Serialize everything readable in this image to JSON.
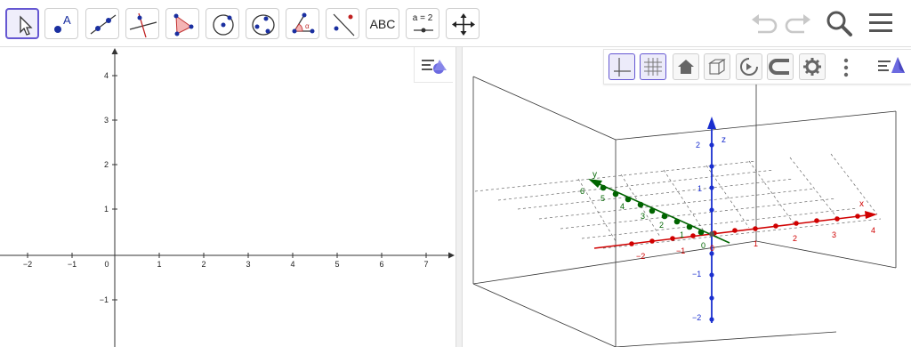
{
  "toolbar": {
    "tools": [
      {
        "name": "move-tool",
        "active": true
      },
      {
        "name": "point-tool"
      },
      {
        "name": "line-tool"
      },
      {
        "name": "perpendicular-line-tool"
      },
      {
        "name": "polygon-tool"
      },
      {
        "name": "circle-center-point-tool"
      },
      {
        "name": "circle-three-points-tool"
      },
      {
        "name": "angle-tool"
      },
      {
        "name": "reflect-about-line-tool"
      },
      {
        "name": "text-tool",
        "label": "ABC"
      },
      {
        "name": "slider-tool",
        "label": "a = 2"
      },
      {
        "name": "move-graphics-view-tool"
      }
    ],
    "right_icons": [
      "undo-icon",
      "redo-icon",
      "search-icon",
      "menu-icon"
    ]
  },
  "graphics2d": {
    "x_ticks": [
      "−2",
      "−1",
      "0",
      "1",
      "2",
      "3",
      "4",
      "5",
      "6",
      "7"
    ],
    "y_ticks": [
      "4",
      "3",
      "2",
      "1",
      "−1"
    ]
  },
  "graphics3d": {
    "x_ticks": [
      "−2",
      "−1",
      "0",
      "1",
      "2",
      "3",
      "4"
    ],
    "y_ticks": [
      "0",
      "1",
      "2",
      "3",
      "4",
      "5",
      "6"
    ],
    "z_ticks": [
      "2",
      "1",
      "−1",
      "−2"
    ],
    "axis_labels": {
      "x": "x",
      "y": "y",
      "z": "z"
    },
    "stylebar": [
      "axes-toggle-icon",
      "grid-toggle-icon",
      "home-icon",
      "view-in-front-icon",
      "rotate-view-icon",
      "projection-icon",
      "settings-icon",
      "more-icon",
      "stylebar-icon"
    ]
  },
  "colors": {
    "accent": "#6557d2",
    "x_axis": "#d00000",
    "y_axis": "#006400",
    "z_axis": "#1a2fcf"
  }
}
